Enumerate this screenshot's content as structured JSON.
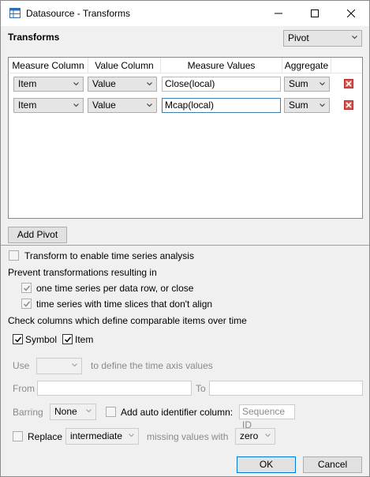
{
  "window": {
    "title": "Datasource - Transforms",
    "minimize_icon": "minimize-icon",
    "maximize_icon": "maximize-icon",
    "close_icon": "close-icon"
  },
  "header": {
    "label": "Transforms",
    "transform_type": "Pivot"
  },
  "grid": {
    "columns": [
      "Measure Column",
      "Value Column",
      "Measure Values",
      "Aggregate"
    ],
    "rows": [
      {
        "measure_column": "Item",
        "value_column": "Value",
        "measure_values": "Close(local)",
        "aggregate": "Sum"
      },
      {
        "measure_column": "Item",
        "value_column": "Value",
        "measure_values": "Mcap(local)",
        "aggregate": "Sum"
      }
    ],
    "delete_color": "#d9534f"
  },
  "add_pivot_label": "Add Pivot",
  "time_series": {
    "enable_label": "Transform to enable time series analysis",
    "enable_checked": false,
    "prevent_heading": "Prevent transformations resulting in",
    "option1_label": "one time series per data row, or close",
    "option1_checked": true,
    "option2_label": "time series with time slices that don't align",
    "option2_checked": true,
    "comparable_heading": "Check columns which define comparable items over time",
    "col_symbol_label": "Symbol",
    "col_symbol_checked": true,
    "col_item_label": "Item",
    "col_item_checked": true,
    "use_label": "Use",
    "use_value": "",
    "use_suffix": "to define the time axis values",
    "from_label": "From",
    "from_value": "",
    "to_label": "To",
    "to_value": "",
    "barring_label": "Barring",
    "barring_value": "None",
    "auto_id_label": "Add auto identifier column:",
    "auto_id_checked": false,
    "auto_id_placeholder": "Sequence ID",
    "replace_label": "Replace",
    "replace_checked": false,
    "replace_value": "intermediate",
    "missing_label": "missing values with",
    "missing_value": "zero"
  },
  "footer": {
    "ok_label": "OK",
    "cancel_label": "Cancel"
  }
}
